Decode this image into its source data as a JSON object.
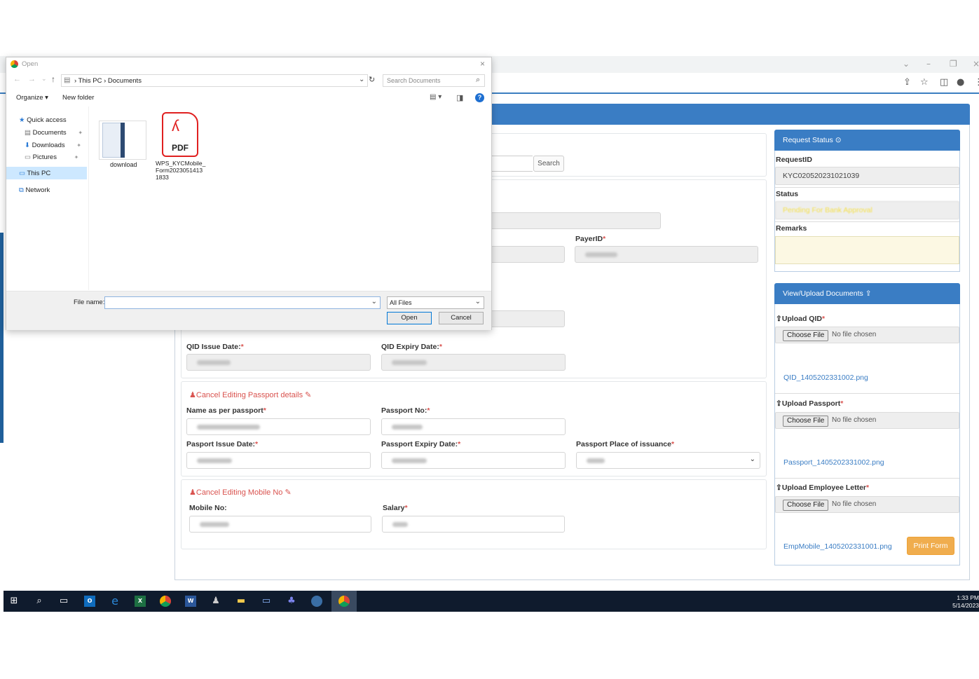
{
  "dialog": {
    "title": "Open",
    "path": [
      "This PC",
      "Documents"
    ],
    "search_placeholder": "Search Documents",
    "toolbar": {
      "organize": "Organize ▾",
      "new_folder": "New folder"
    },
    "nav": {
      "quick_access": "Quick access",
      "documents": "Documents",
      "downloads": "Downloads",
      "pictures": "Pictures",
      "this_pc": "This PC",
      "network": "Network"
    },
    "files": [
      {
        "name": "download"
      },
      {
        "name": "WPS_KYCMobile_ Form2023051413 1833",
        "badge": "PDF"
      }
    ],
    "file_name_label": "File name:",
    "file_name_value": "",
    "filter": "All Files",
    "open_label": "Open",
    "cancel_label": "Cancel"
  },
  "form": {
    "search_label": "Search",
    "payer_id_label": "PayerID",
    "qid_issue_label": "QID Issue Date:",
    "qid_expiry_label": "QID Expiry Date:",
    "cancel_passport": "Cancel Editing Passport details",
    "name_passport_label": "Name as per passport",
    "passport_no_label": "Passport No:",
    "passport_issue_label": "Pasport Issue Date:",
    "passport_expiry_label": "Passport Expiry Date:",
    "passport_place_label": "Passport Place of issuance",
    "cancel_mobile": "Cancel Editing Mobile No",
    "mobile_label": "Mobile No:",
    "salary_label": "Salary",
    "required_mark": "*"
  },
  "request_status": {
    "header": "Request Status",
    "request_id_label": "RequestID",
    "request_id": "KYC020520231021039",
    "status_label": "Status",
    "status_value": "Pending For Bank Approval",
    "remarks_label": "Remarks"
  },
  "documents": {
    "header": "View/Upload Documents",
    "upload_qid": "Upload QID",
    "upload_passport": "Upload Passport",
    "upload_letter": "Upload Employee Letter",
    "choose_file": "Choose File",
    "no_file": "No file chosen",
    "qid_file": "QID_1405202331002.png",
    "passport_file": "Passport_1405202331002.png",
    "letter_file": "EmpMobile_1405202331001.png",
    "print_form": "Print Form"
  },
  "taskbar": {
    "time": "1:33 PM",
    "date": "5/14/2023"
  },
  "colors": {
    "primary": "#3a7dc4",
    "required": "#d9534f",
    "print": "#f0ad4e",
    "status": "#f4e04d"
  }
}
